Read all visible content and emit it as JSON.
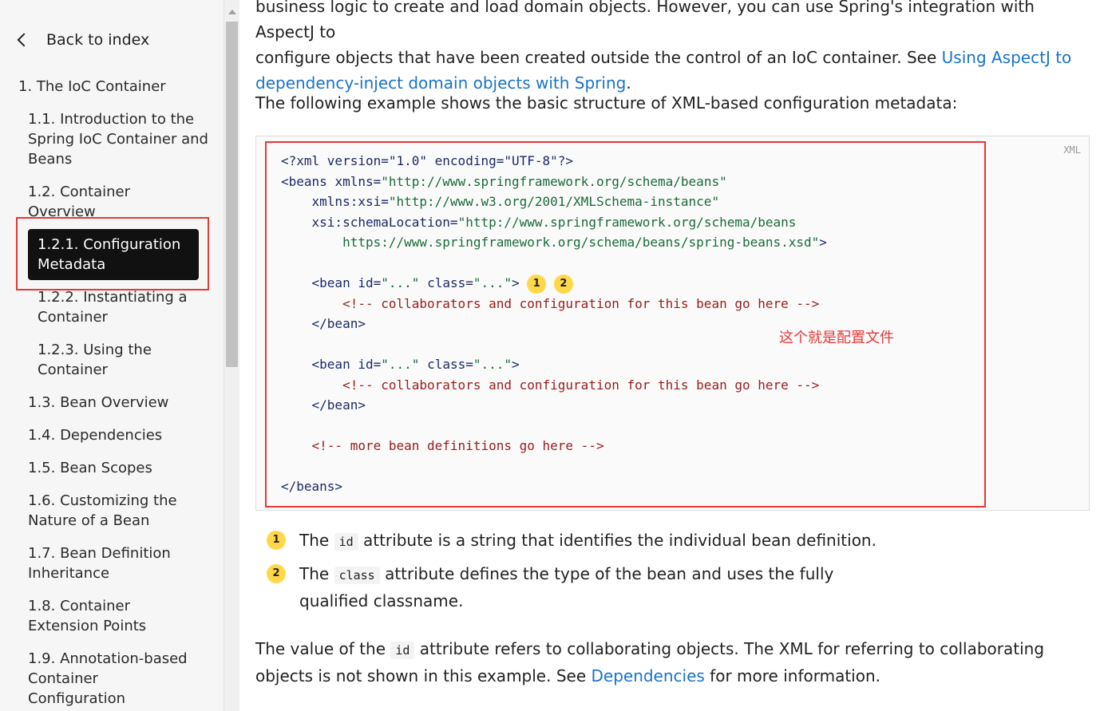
{
  "sidebar": {
    "back_label": "Back to index",
    "items": [
      {
        "label": "1. The IoC Container"
      },
      {
        "label": "1.1. Introduction to the Spring IoC Container and Beans"
      },
      {
        "label": "1.2. Container Overview"
      },
      {
        "label": "1.2.1. Configuration Metadata",
        "active": true
      },
      {
        "label": "1.2.2. Instantiating a Container"
      },
      {
        "label": "1.2.3. Using the Container"
      },
      {
        "label": "1.3. Bean Overview"
      },
      {
        "label": "1.4. Dependencies"
      },
      {
        "label": "1.5. Bean Scopes"
      },
      {
        "label": "1.6. Customizing the Nature of a Bean"
      },
      {
        "label": "1.7. Bean Definition Inheritance"
      },
      {
        "label": "1.8. Container Extension Points"
      },
      {
        "label": "1.9. Annotation-based Container Configuration"
      }
    ]
  },
  "content": {
    "intro_line1": "business logic to create and load domain objects. However, you can use Spring's integration with AspectJ to",
    "intro_line2": "configure objects that have been created outside the control of an IoC container. See ",
    "intro_link": "Using AspectJ to dependency-inject domain objects with Spring",
    "intro_end": ".",
    "example_intro": "The following example shows the basic structure of XML-based configuration metadata:",
    "code": {
      "language": "XML",
      "decl": "<?xml version=\"1.0\" encoding=\"UTF-8\"?>",
      "beans_open": "<beans",
      "xmlns_attr": "xmlns=",
      "xmlns_val": "\"http://www.springframework.org/schema/beans\"",
      "xsi_attr": "xmlns:xsi=",
      "xsi_val": "\"http://www.w3.org/2001/XMLSchema-instance\"",
      "schema_attr": "xsi:schemaLocation=",
      "schema_val1": "\"http://www.springframework.org/schema/beans",
      "schema_val2": "https://www.springframework.org/schema/beans/spring-beans.xsd\"",
      "gt": ">",
      "bean_open": "<bean",
      "id_attr": "id=",
      "class_attr": "class=",
      "dots": "\"...\"",
      "comment": "<!-- collaborators and configuration for this bean go here -->",
      "bean_close": "</bean>",
      "more_comment": "<!-- more bean definitions go here -->",
      "beans_close": "</beans>",
      "badge1": "1",
      "badge2": "2",
      "annotation": "这个就是配置文件"
    },
    "callout1": {
      "badge": "1",
      "pre": "The ",
      "code": "id",
      "post": " attribute is a string that identifies the individual bean definition."
    },
    "callout2": {
      "badge": "2",
      "pre": "The ",
      "code": "class",
      "post": " attribute defines the type of the bean and uses the fully qualified classname."
    },
    "value_para": {
      "pre": "The value of the ",
      "code": "id",
      "mid": " attribute refers to collaborating objects. The XML for referring to collaborating objects is not shown in this example. See ",
      "link": "Dependencies",
      "post": " for more information."
    }
  }
}
